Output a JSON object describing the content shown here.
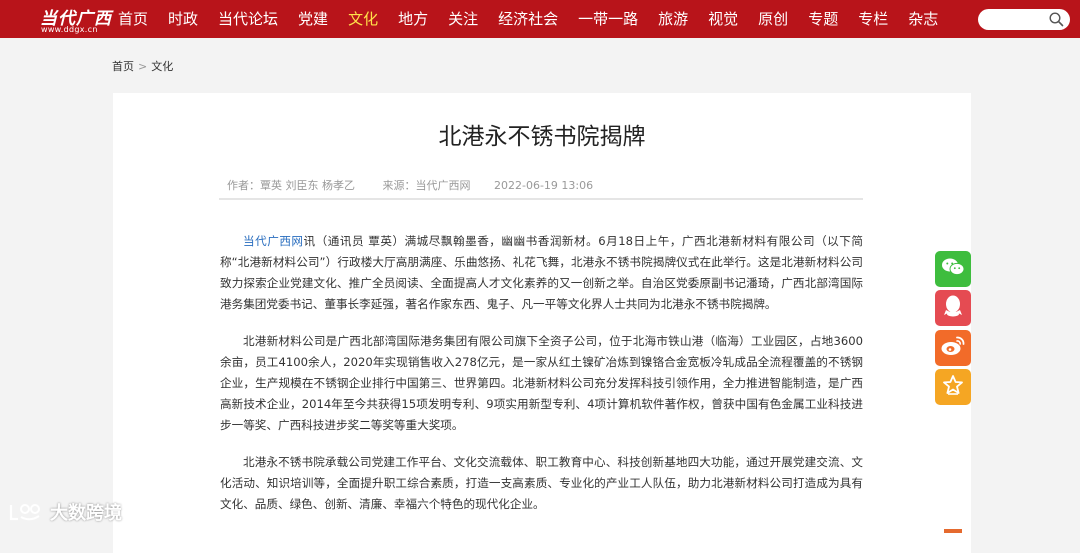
{
  "header": {
    "logo_text": "当代广西",
    "logo_url": "www.ddgx.cn",
    "nav": [
      {
        "label": "首页",
        "active": false
      },
      {
        "label": "时政",
        "active": false
      },
      {
        "label": "当代论坛",
        "active": false
      },
      {
        "label": "党建",
        "active": false
      },
      {
        "label": "文化",
        "active": true
      },
      {
        "label": "地方",
        "active": false
      },
      {
        "label": "关注",
        "active": false
      },
      {
        "label": "经济社会",
        "active": false
      },
      {
        "label": "一带一路",
        "active": false
      },
      {
        "label": "旅游",
        "active": false
      },
      {
        "label": "视觉",
        "active": false
      },
      {
        "label": "原创",
        "active": false
      },
      {
        "label": "专题",
        "active": false
      },
      {
        "label": "专栏",
        "active": false
      },
      {
        "label": "杂志",
        "active": false
      }
    ],
    "search": {
      "placeholder": "",
      "icon": "search-icon"
    },
    "colors": {
      "brand": "#b8141a",
      "active_nav": "#ffe14a"
    }
  },
  "breadcrumb": {
    "home": "首页",
    "separator": ">",
    "current": "文化"
  },
  "article": {
    "title": "北港永不锈书院揭牌",
    "authors": "作者：覃英  刘臣东  杨孝乙",
    "source": "来源：当代广西网",
    "date": "2022-06-19 13:06",
    "paragraphs": [
      {
        "link": "当代广西网",
        "text": "讯（通讯员 覃英）满城尽飘翰墨香，幽幽书香润新材。6月18日上午，广西北港新材料有限公司（以下简称“北港新材料公司”）行政楼大厅高朋满座、乐曲悠扬、礼花飞舞，北港永不锈书院揭牌仪式在此举行。这是北港新材料公司致力探索企业党建文化、推广全员阅读、全面提高人才文化素养的又一创新之举。自治区党委原副书记潘琦，广西北部湾国际港务集团党委书记、董事长李延强，著名作家东西、鬼子、凡一平等文化界人士共同为北港永不锈书院揭牌。"
      },
      {
        "link": "",
        "text": "北港新材料公司是广西北部湾国际港务集团有限公司旗下全资子公司，位于北海市铁山港（临海）工业园区，占地3600余亩，员工4100余人，2020年实现销售收入278亿元，是一家从红土镍矿冶炼到镍铬合金宽板冷轧成品全流程覆盖的不锈钢企业，生产规模在不锈钢企业排行中国第三、世界第四。北港新材料公司充分发挥科技引领作用，全力推进智能制造，是广西高新技术企业，2014年至今共获得15项发明专利、9项实用新型专利、4项计算机软件著作权，曾获中国有色金属工业科技进步一等奖、广西科技进步奖二等奖等重大奖项。"
      },
      {
        "link": "",
        "text": "北港永不锈书院承载公司党建工作平台、文化交流载体、职工教育中心、科技创新基地四大功能，通过开展党建交流、文化活动、知识培训等，全面提升职工综合素质，打造一支高素质、专业化的产业工人队伍，助力北港新材料公司打造成为具有文化、品质、绿色、创新、清廉、幸福六个特色的现代化企业。"
      }
    ]
  },
  "share": [
    {
      "name": "wechat-share-icon",
      "color": "#3ebd3e"
    },
    {
      "name": "qq-share-icon",
      "color": "#e54b52"
    },
    {
      "name": "weibo-share-icon",
      "color": "#f26b29"
    },
    {
      "name": "favorite-icon",
      "color": "#f5a623"
    }
  ],
  "watermark": {
    "text": "大数跨境"
  }
}
